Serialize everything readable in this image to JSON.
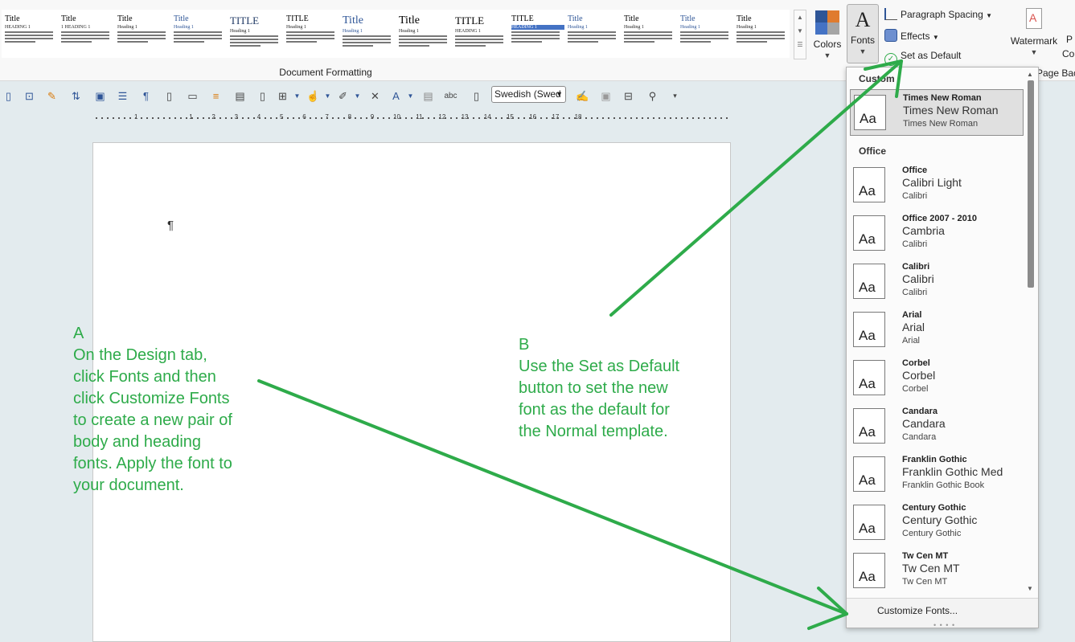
{
  "ribbon": {
    "style_gallery": [
      {
        "title": "Title",
        "heading": "HEADING 1"
      },
      {
        "title": "Title",
        "heading": "1 HEADING 1"
      },
      {
        "title": "Title",
        "heading": "Heading 1"
      },
      {
        "title": "Title",
        "heading": "Heading 1"
      },
      {
        "title": "TITLE",
        "heading": "Heading 1"
      },
      {
        "title": "TITLE",
        "heading": "Heading 1"
      },
      {
        "title": "Title",
        "heading": "Heading 1"
      },
      {
        "title": "Title",
        "heading": "Heading 1"
      },
      {
        "title": "TITLE",
        "heading": "HEADING 1"
      },
      {
        "title": "TITLE",
        "heading": "HEADING 1"
      },
      {
        "title": "Title",
        "heading": "Heading 1"
      },
      {
        "title": "Title",
        "heading": "Heading 1"
      },
      {
        "title": "Title",
        "heading": "Heading 1"
      },
      {
        "title": "Title",
        "heading": "Heading 1"
      }
    ],
    "group_label": "Document Formatting",
    "colors_label": "Colors",
    "fonts_label": "Fonts",
    "fonts_glyph": "A",
    "paragraph_spacing_label": "Paragraph Spacing",
    "effects_label": "Effects",
    "set_default_label": "Set as Default",
    "watermark_label": "Watermark",
    "page_back_label": "Page Back",
    "p_cut": "P",
    "co_cut": "Co",
    "colors": [
      "#2e5597",
      "#e07b2e",
      "#4472c4",
      "#a5a5a5"
    ]
  },
  "toolbar": {
    "language": "Swedish (Swed"
  },
  "ruler": {
    "numbers": [
      "1",
      "1",
      "2",
      "3",
      "4",
      "5",
      "6",
      "7",
      "8",
      "9",
      "10",
      "11",
      "12",
      "13",
      "14",
      "15",
      "16",
      "17",
      "18"
    ]
  },
  "document": {
    "pilcrow": "¶"
  },
  "annotations": {
    "a": "A\nOn the Design tab,\nclick Fonts and then\nclick Customize Fonts\nto create a new pair of\nbody and heading\nfonts. Apply the font to\nyour document.",
    "b": "B\nUse the Set as Default\nbutton to set the new\nfont as the default for\nthe Normal template.",
    "color": "#2eab4a"
  },
  "fonts_menu": {
    "custom_header": "Custom",
    "office_header": "Office",
    "aa_glyph": "Aa",
    "custom_items": [
      {
        "name": "Times New Roman",
        "heading": "Times New Roman",
        "body": "Times New Roman"
      }
    ],
    "office_items": [
      {
        "name": "Office",
        "heading": "Calibri Light",
        "body": "Calibri"
      },
      {
        "name": "Office 2007 - 2010",
        "heading": "Cambria",
        "body": "Calibri"
      },
      {
        "name": "Calibri",
        "heading": "Calibri",
        "body": "Calibri"
      },
      {
        "name": "Arial",
        "heading": "Arial",
        "body": "Arial"
      },
      {
        "name": "Corbel",
        "heading": "Corbel",
        "body": "Corbel"
      },
      {
        "name": "Candara",
        "heading": "Candara",
        "body": "Candara"
      },
      {
        "name": "Franklin Gothic",
        "heading": "Franklin Gothic Med",
        "body": "Franklin Gothic Book"
      },
      {
        "name": "Century Gothic",
        "heading": "Century Gothic",
        "body": "Century Gothic"
      },
      {
        "name": "Tw Cen MT",
        "heading": "Tw Cen MT",
        "body": "Tw Cen MT"
      }
    ],
    "customize_label": "Customize Fonts..."
  }
}
